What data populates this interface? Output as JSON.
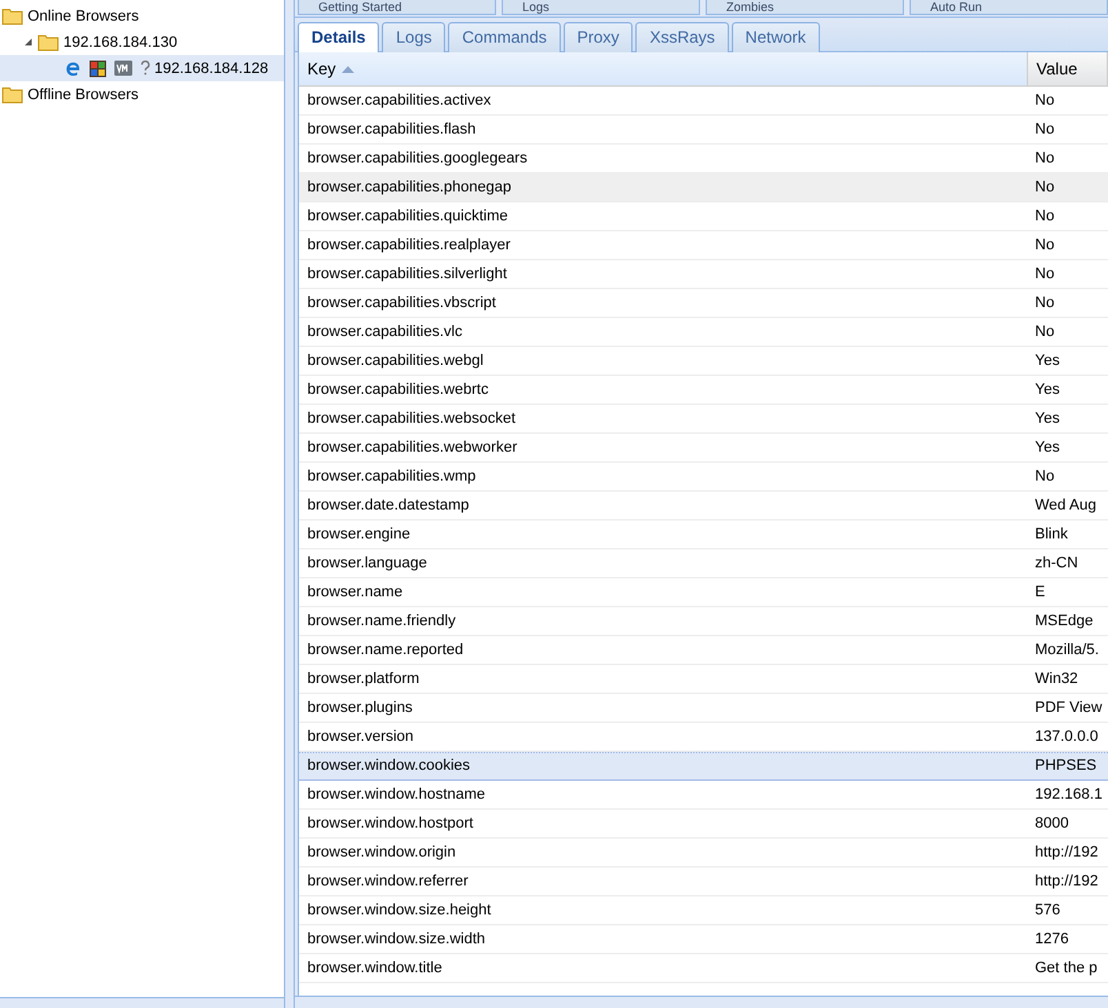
{
  "tree": [
    {
      "label": "Online Browsers",
      "selected": false,
      "children": [
        {
          "label": "192.168.184.130",
          "selected": false,
          "expanded": true,
          "children": [
            {
              "label": "192.168.184.128",
              "selected": true
            }
          ]
        }
      ]
    },
    {
      "label": "Offline Browsers",
      "selected": false
    }
  ],
  "top_tabs": [
    {
      "label": "Getting Started",
      "selected": false
    },
    {
      "label": "Logs",
      "selected": false
    },
    {
      "label": "Zombies",
      "selected": false
    },
    {
      "label": "Auto Run",
      "selected": false
    }
  ],
  "tabs": [
    {
      "label": "Details",
      "selected": true
    },
    {
      "label": "Logs",
      "selected": false
    },
    {
      "label": "Commands",
      "selected": false
    },
    {
      "label": "Proxy",
      "selected": false
    },
    {
      "label": "XssRays",
      "selected": false
    },
    {
      "label": "Network",
      "selected": false
    }
  ],
  "table": {
    "columns": [
      {
        "label": "Key",
        "sorted": true
      },
      {
        "label": "Value",
        "sorted": false
      }
    ],
    "rows": [
      {
        "key": "browser.capabilities.activex",
        "value": "No",
        "selected": false,
        "hovered": false
      },
      {
        "key": "browser.capabilities.flash",
        "value": "No",
        "selected": false,
        "hovered": false
      },
      {
        "key": "browser.capabilities.googlegears",
        "value": "No",
        "selected": false,
        "hovered": false
      },
      {
        "key": "browser.capabilities.phonegap",
        "value": "No",
        "selected": false,
        "hovered": true
      },
      {
        "key": "browser.capabilities.quicktime",
        "value": "No",
        "selected": false,
        "hovered": false
      },
      {
        "key": "browser.capabilities.realplayer",
        "value": "No",
        "selected": false,
        "hovered": false
      },
      {
        "key": "browser.capabilities.silverlight",
        "value": "No",
        "selected": false,
        "hovered": false
      },
      {
        "key": "browser.capabilities.vbscript",
        "value": "No",
        "selected": false,
        "hovered": false
      },
      {
        "key": "browser.capabilities.vlc",
        "value": "No",
        "selected": false,
        "hovered": false
      },
      {
        "key": "browser.capabilities.webgl",
        "value": "Yes",
        "selected": false,
        "hovered": false
      },
      {
        "key": "browser.capabilities.webrtc",
        "value": "Yes",
        "selected": false,
        "hovered": false
      },
      {
        "key": "browser.capabilities.websocket",
        "value": "Yes",
        "selected": false,
        "hovered": false
      },
      {
        "key": "browser.capabilities.webworker",
        "value": "Yes",
        "selected": false,
        "hovered": false
      },
      {
        "key": "browser.capabilities.wmp",
        "value": "No",
        "selected": false,
        "hovered": false
      },
      {
        "key": "browser.date.datestamp",
        "value": "Wed Aug",
        "selected": false,
        "hovered": false
      },
      {
        "key": "browser.engine",
        "value": "Blink",
        "selected": false,
        "hovered": false
      },
      {
        "key": "browser.language",
        "value": "zh-CN",
        "selected": false,
        "hovered": false
      },
      {
        "key": "browser.name",
        "value": "E",
        "selected": false,
        "hovered": false
      },
      {
        "key": "browser.name.friendly",
        "value": "MSEdge",
        "selected": false,
        "hovered": false
      },
      {
        "key": "browser.name.reported",
        "value": "Mozilla/5.",
        "selected": false,
        "hovered": false
      },
      {
        "key": "browser.platform",
        "value": "Win32",
        "selected": false,
        "hovered": false
      },
      {
        "key": "browser.plugins",
        "value": "PDF View",
        "selected": false,
        "hovered": false
      },
      {
        "key": "browser.version",
        "value": "137.0.0.0",
        "selected": false,
        "hovered": false
      },
      {
        "key": "browser.window.cookies",
        "value": "PHPSES",
        "selected": true,
        "hovered": false
      },
      {
        "key": "browser.window.hostname",
        "value": "192.168.1",
        "selected": false,
        "hovered": false
      },
      {
        "key": "browser.window.hostport",
        "value": "8000",
        "selected": false,
        "hovered": false
      },
      {
        "key": "browser.window.origin",
        "value": "http://192",
        "selected": false,
        "hovered": false
      },
      {
        "key": "browser.window.referrer",
        "value": "http://192",
        "selected": false,
        "hovered": false
      },
      {
        "key": "browser.window.size.height",
        "value": "576",
        "selected": false,
        "hovered": false
      },
      {
        "key": "browser.window.size.width",
        "value": "1276",
        "selected": false,
        "hovered": false
      },
      {
        "key": "browser.window.title",
        "value": "Get the p",
        "selected": false,
        "hovered": false
      }
    ]
  }
}
